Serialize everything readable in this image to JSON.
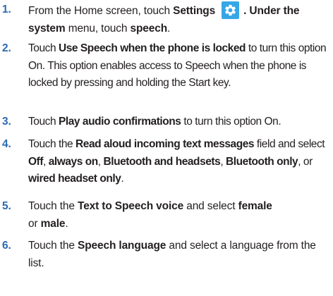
{
  "steps": [
    {
      "number": "1.",
      "parts": [
        "From the Home screen, touch ",
        "Settings",
        ". Under the ",
        "system",
        " menu, touch ",
        "speech",
        "."
      ],
      "icon": "settings-gear-icon"
    },
    {
      "number": "2.",
      "parts": [
        "Touch ",
        "Use Speech when the phone is locked",
        " to turn this option On. This option enables access to Speech when the phone is locked by pressing and holding the Start key."
      ]
    },
    {
      "number": "3.",
      "parts": [
        "Touch ",
        "Play audio confirmations",
        " to turn this option On."
      ]
    },
    {
      "number": "4.",
      "parts": [
        "Touch the ",
        "Read aloud incoming text messages",
        " field and select ",
        "Off",
        ", ",
        "always on",
        ", ",
        "Bluetooth and headsets",
        ", ",
        "Bluetooth only",
        ", or ",
        "wired headset only",
        "."
      ]
    },
    {
      "number": "5.",
      "parts": [
        "Touch the ",
        "Text to Speech voice",
        " and select ",
        "female",
        " or ",
        "male",
        "."
      ]
    },
    {
      "number": "6.",
      "parts": [
        "Touch the ",
        "Speech language",
        " and select a language from the list."
      ]
    }
  ],
  "colors": {
    "step_number": "#2a6ab3",
    "icon_background": "#36a7e6",
    "text": "#231f20"
  }
}
